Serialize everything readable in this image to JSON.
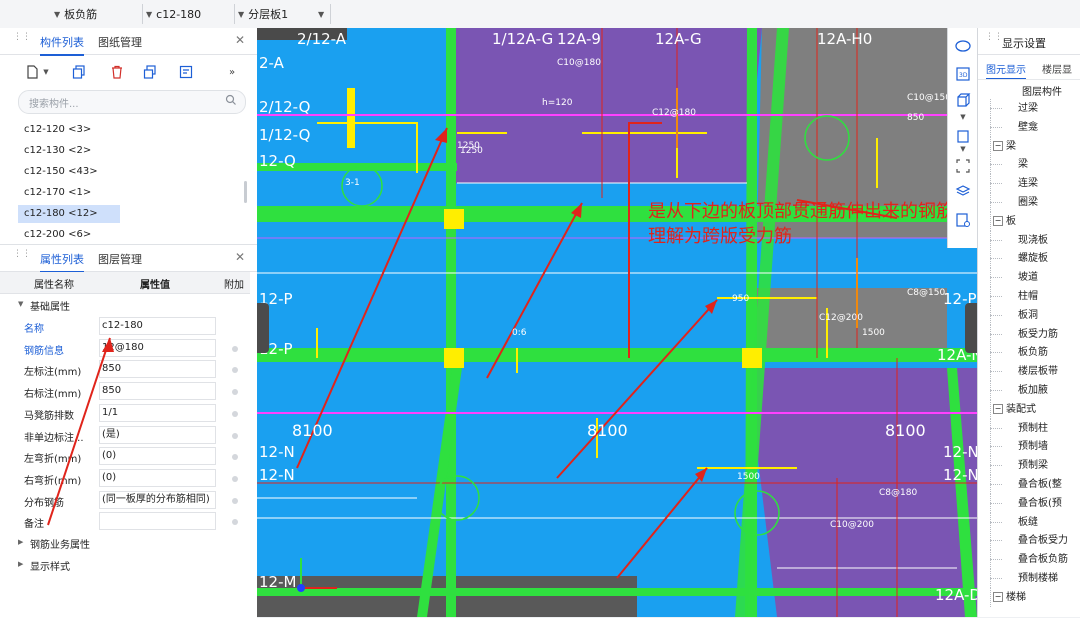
{
  "toolbar": {
    "dropdown1": "板负筋",
    "dropdown2": "c12-180",
    "dropdown3": "分层板1"
  },
  "component_panel": {
    "tabs": [
      "构件列表",
      "图纸管理"
    ],
    "search_placeholder": "搜索构件...",
    "items": [
      "c12-120 <3>",
      "c12-130 <2>",
      "c12-150 <43>",
      "c12-170 <1>",
      "c12-180 <12>",
      "c12-200 <6>"
    ],
    "selected_index": 4
  },
  "property_panel": {
    "tabs": [
      "属性列表",
      "图层管理"
    ],
    "columns": [
      "属性名称",
      "属性值",
      "附加"
    ],
    "section_basic": "基础属性",
    "rows": [
      {
        "name": "名称",
        "value": "c12-180",
        "blue": true,
        "dot": false
      },
      {
        "name": "钢筋信息",
        "value": "12@180",
        "blue": true,
        "dot": true
      },
      {
        "name": "左标注(mm)",
        "value": "850",
        "blue": false,
        "dot": true
      },
      {
        "name": "右标注(mm)",
        "value": "850",
        "blue": false,
        "dot": true
      },
      {
        "name": "马凳筋排数",
        "value": "1/1",
        "blue": false,
        "dot": true
      },
      {
        "name": "非单边标注...",
        "value": "(是)",
        "blue": false,
        "dot": true
      },
      {
        "name": "左弯折(mm)",
        "value": "(0)",
        "blue": false,
        "dot": true
      },
      {
        "name": "右弯折(mm)",
        "value": "(0)",
        "blue": false,
        "dot": true
      },
      {
        "name": "分布钢筋",
        "value": "(同一板厚的分布筋相同)",
        "blue": false,
        "dot": true
      },
      {
        "name": "备注",
        "value": "",
        "blue": false,
        "dot": true
      }
    ],
    "section_rebar": "钢筋业务属性",
    "section_display": "显示样式"
  },
  "display_panel": {
    "title": "显示设置",
    "tabs": [
      "图元显示",
      "楼层显"
    ],
    "header": "图层构件",
    "items": [
      {
        "label": "过梁",
        "level": 2
      },
      {
        "label": "壁龛",
        "level": 2
      },
      {
        "label": "梁",
        "level": 1
      },
      {
        "label": "梁",
        "level": 2
      },
      {
        "label": "连梁",
        "level": 2
      },
      {
        "label": "圈梁",
        "level": 2
      },
      {
        "label": "板",
        "level": 1
      },
      {
        "label": "现浇板",
        "level": 2
      },
      {
        "label": "螺旋板",
        "level": 2
      },
      {
        "label": "坡道",
        "level": 2
      },
      {
        "label": "柱帽",
        "level": 2
      },
      {
        "label": "板洞",
        "level": 2
      },
      {
        "label": "板受力筋",
        "level": 2
      },
      {
        "label": "板负筋",
        "level": 2
      },
      {
        "label": "楼层板带",
        "level": 2
      },
      {
        "label": "板加腋",
        "level": 2
      },
      {
        "label": "装配式",
        "level": 1
      },
      {
        "label": "预制柱",
        "level": 2
      },
      {
        "label": "预制墙",
        "level": 2
      },
      {
        "label": "预制梁",
        "level": 2
      },
      {
        "label": "叠合板(整",
        "level": 2
      },
      {
        "label": "叠合板(预",
        "level": 2
      },
      {
        "label": "板缝",
        "level": 2
      },
      {
        "label": "叠合板受力",
        "level": 2
      },
      {
        "label": "叠合板负筋",
        "level": 2
      },
      {
        "label": "预制楼梯",
        "level": 2
      },
      {
        "label": "楼梯",
        "level": 1
      }
    ]
  },
  "drawing": {
    "axis_top": [
      "2/12-A",
      "1/12A-G",
      "12A-9",
      "12A-G",
      "12A-H0"
    ],
    "axis_left": [
      "2-A",
      "2/12-Q",
      "1/12-Q",
      "12-Q",
      "12-P",
      "12-P",
      "12-N",
      "12-N",
      "12-M"
    ],
    "axis_right": [
      "12-P",
      "12A-N",
      "12-N",
      "12-N",
      "12A-D"
    ],
    "dims": [
      "8100",
      "8100",
      "8100"
    ],
    "labels": [
      "C10@180",
      "h=120",
      "C12@180",
      "1250",
      "C10@150",
      "850",
      "3-1",
      "950",
      "C8@150",
      "C12@200",
      "1500",
      "1500",
      "C8@180",
      "C10@200",
      "0:6",
      "1250"
    ],
    "annotation_line1": "是从下边的板顶部贯通筋伸出来的钢筋，可以",
    "annotation_line2": "理解为跨版受力筋"
  },
  "colors": {
    "slab_blue": "#1aa0f0",
    "slab_purple": "#7a55b3",
    "slab_gray": "#808080",
    "beam_green": "#2fe03f",
    "column_yellow": "#ffee00",
    "annotation_red": "#e0241b",
    "accent_blue": "#1d5fd6"
  }
}
